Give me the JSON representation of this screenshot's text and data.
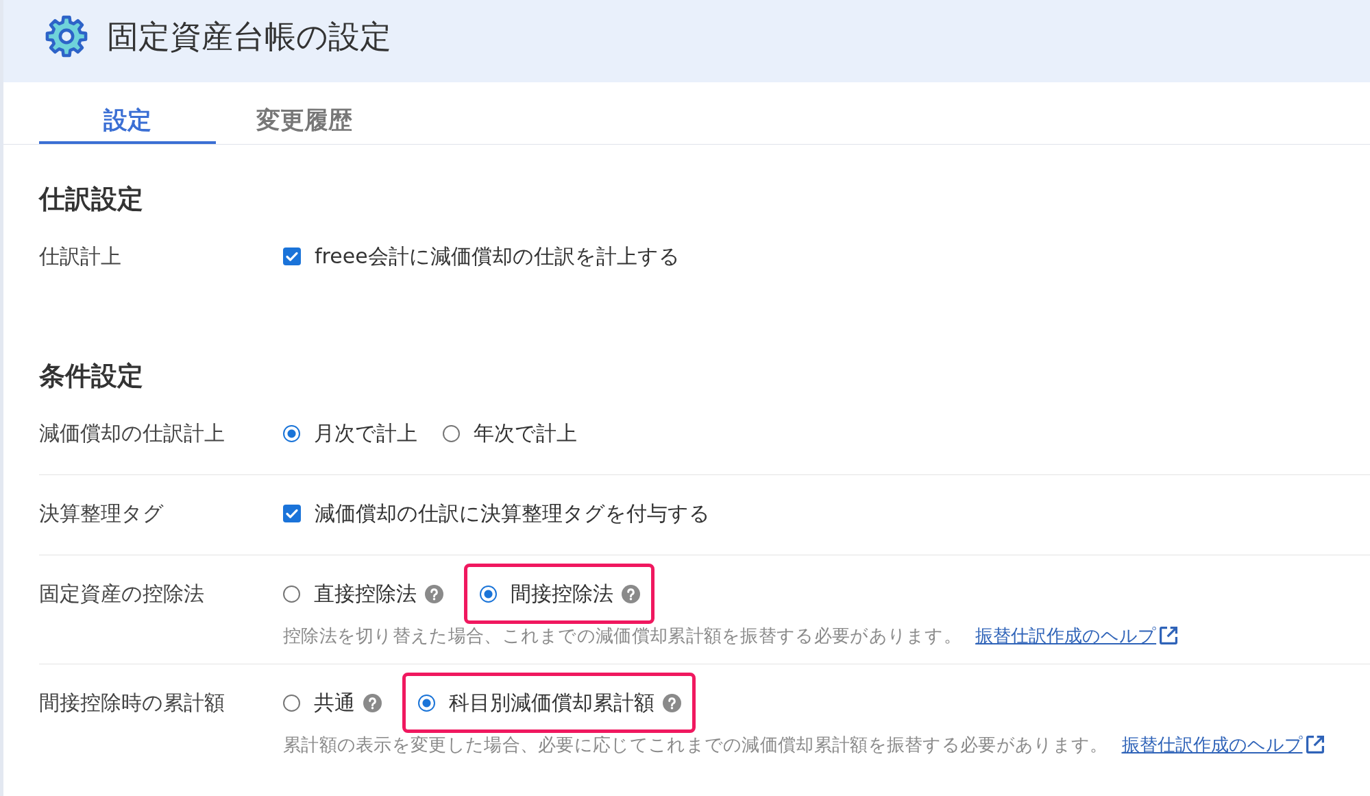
{
  "header": {
    "title": "固定資産台帳の設定"
  },
  "tabs": [
    {
      "label": "設定",
      "selected": true
    },
    {
      "label": "変更履歴",
      "selected": false
    }
  ],
  "sections": [
    {
      "heading": "仕訳設定",
      "rows": [
        {
          "label": "仕訳計上",
          "kind": "checkbox",
          "options": [
            {
              "label": "freee会計に減価償却の仕訳を計上する",
              "checked": true
            }
          ]
        }
      ]
    },
    {
      "heading": "条件設定",
      "rows": [
        {
          "label": "減価償却の仕訳計上",
          "kind": "radio",
          "options": [
            {
              "label": "月次で計上",
              "selected": true
            },
            {
              "label": "年次で計上",
              "selected": false
            }
          ]
        },
        {
          "label": "決算整理タグ",
          "kind": "checkbox",
          "options": [
            {
              "label": "減価償却の仕訳に決算整理タグを付与する",
              "checked": true
            }
          ]
        },
        {
          "label": "固定資産の控除法",
          "kind": "radio",
          "options": [
            {
              "label": "直接控除法",
              "selected": false,
              "help": true,
              "highlighted": false
            },
            {
              "label": "間接控除法",
              "selected": true,
              "help": true,
              "highlighted": true
            }
          ],
          "note": "控除法を切り替えた場合、これまでの減価償却累計額を振替する必要があります。",
          "link": "振替仕訳作成のヘルプ"
        },
        {
          "label": "間接控除時の累計額",
          "kind": "radio",
          "options": [
            {
              "label": "共通",
              "selected": false,
              "help": true,
              "highlighted": false
            },
            {
              "label": "科目別減価償却累計額",
              "selected": true,
              "help": true,
              "highlighted": true
            }
          ],
          "note": "累計額の表示を変更した場合、必要に応じてこれまでの減価償却累計額を振替する必要があります。",
          "link": "振替仕訳作成のヘルプ"
        }
      ]
    }
  ]
}
